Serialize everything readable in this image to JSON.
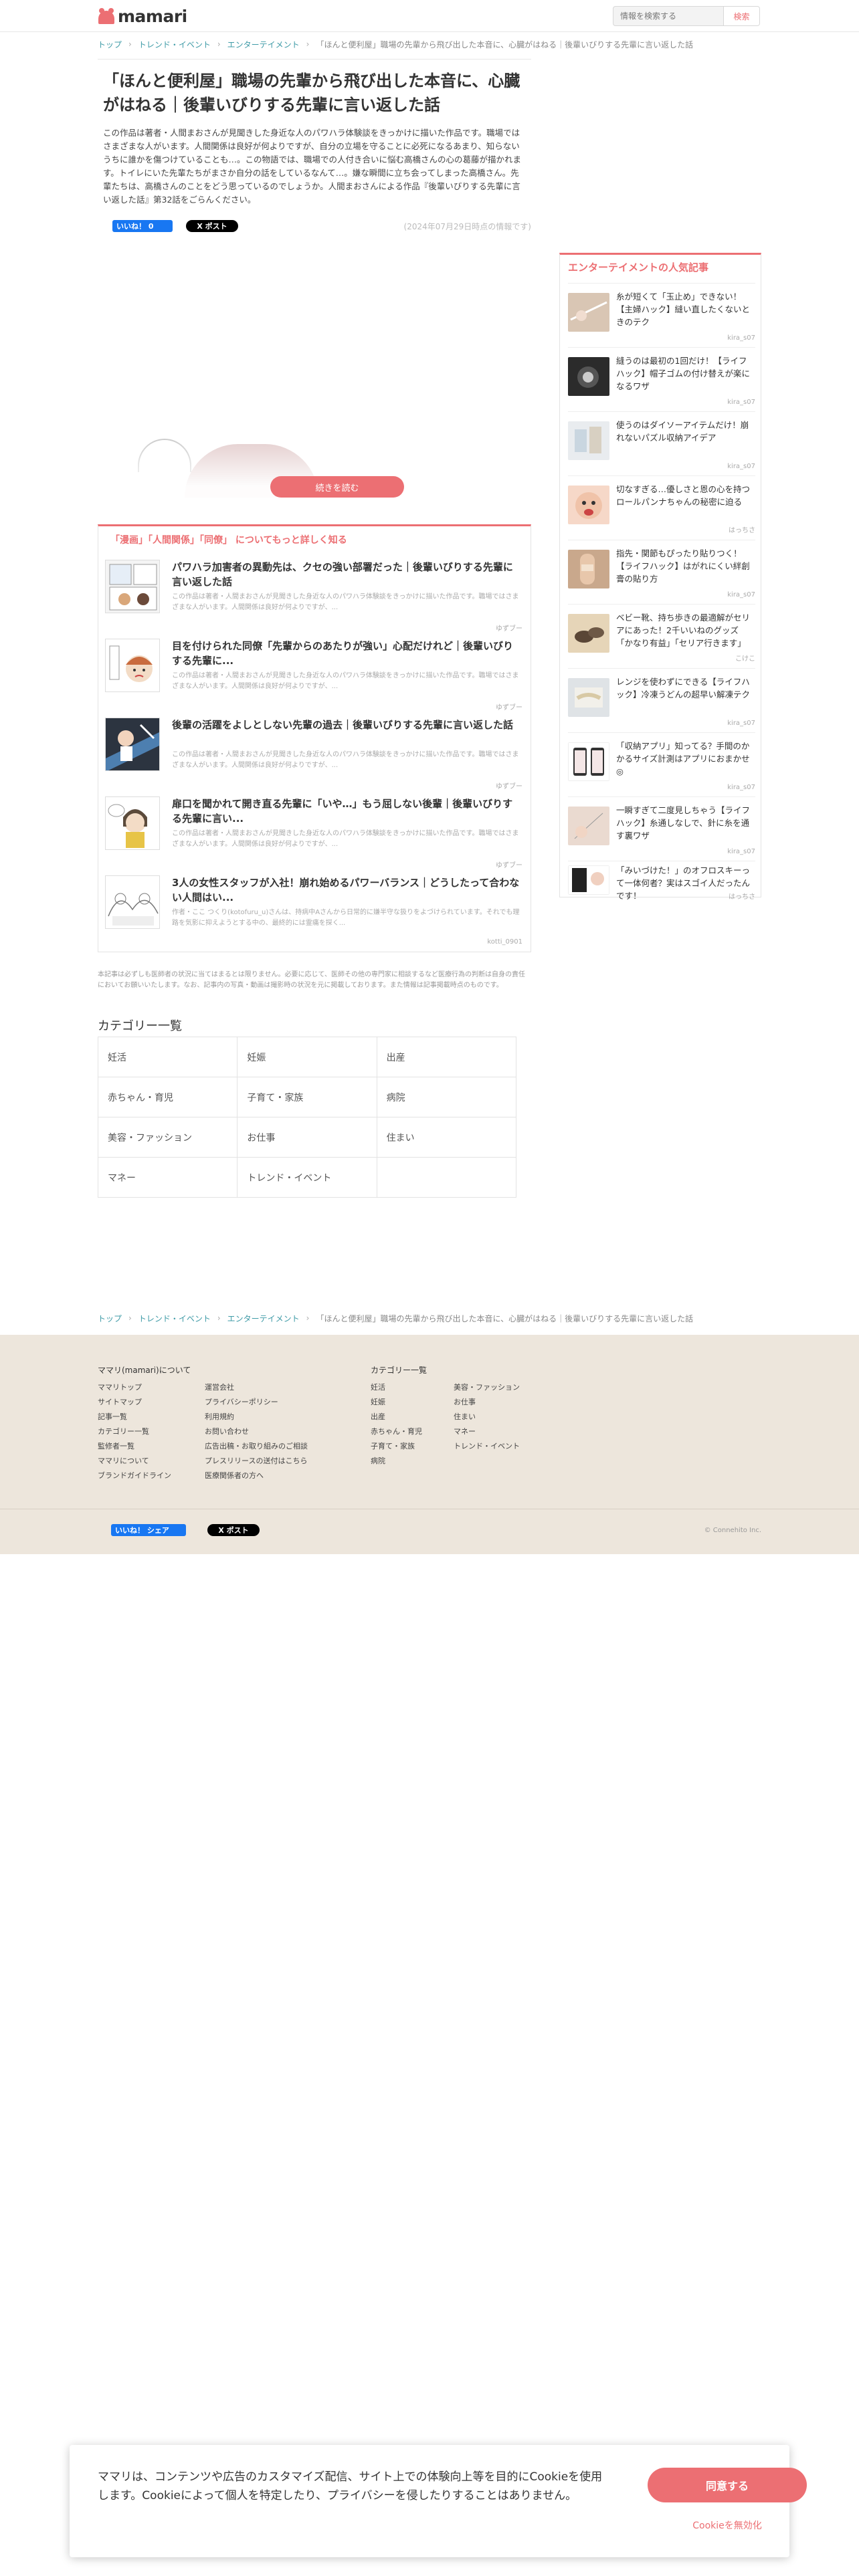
{
  "header": {
    "logo_text": "mamari",
    "search_placeholder": "情報を検索する",
    "search_button": "検索"
  },
  "breadcrumb": {
    "items": [
      "トップ",
      "トレンド・イベント",
      "エンターテイメント"
    ],
    "current": "「ほんと便利屋」職場の先輩から飛び出した本音に、心臓がはねる｜後輩いびりする先輩に言い返した話"
  },
  "article": {
    "title": "「ほんと便利屋」職場の先輩から飛び出した本音に、心臓がはねる｜後輩いびりする先輩に言い返した話",
    "lead": "この作品は著者・人間まおさんが見聞きした身近な人のパワハラ体験談をきっかけに描いた作品です。職場ではさまざまな人がいます。人間関係は良好が何よりですが、自分の立場を守ることに必死になるあまり、知らないうちに誰かを傷つけていることも…。この物語では、職場での人付き合いに悩む高橋さんの心の葛藤が描かれます。トイレにいた先輩たちがまさか自分の話をしているなんて…。嫌な瞬間に立ち会ってしまった高橋さん。先輩たちは、高橋さんのことをどう思っているのでしょうか。人間まおさんによる作品『後輩いびりする先輩に言い返した話』第32話をごらんください。",
    "fb_like": "いいね！ 0",
    "x_post": "X ポスト",
    "date": "(2024年07月29日時点の情報です)",
    "continue_button": "続きを読む"
  },
  "related": {
    "title": "「漫画」「人間関係」「同僚」 についてもっと詳しく知る",
    "items": [
      {
        "headline": "パワハラ加害者の異動先は、クセの強い部署だった｜後輩いびりする先輩に言い返した話",
        "desc": "この作品は著者・人間まおさんが見聞きした身近な人のパワハラ体験談をきっかけに描いた作品です。職場ではさまざまな人がいます。人間関係は良好が何よりですが、...",
        "author": "ゆずブー"
      },
      {
        "headline": "目を付けられた同僚「先輩からのあたりが強い」心配だけれど｜後輩いびりする先輩に...",
        "desc": "この作品は著者・人間まおさんが見聞きした身近な人のパワハラ体験談をきっかけに描いた作品です。職場ではさまざまな人がいます。人間関係は良好が何よりですが、...",
        "author": "ゆずブー"
      },
      {
        "headline": "後輩の活躍をよしとしない先輩の過去｜後輩いびりする先輩に言い返した話",
        "desc": "この作品は著者・人間まおさんが見聞きした身近な人のパワハラ体験談をきっかけに描いた作品です。職場ではさまざまな人がいます。人間関係は良好が何よりですが、...",
        "author": "ゆずブー"
      },
      {
        "headline": "扉口を聞かれて開き直る先輩に「いや…」もう屈しない後輩｜後輩いびりする先輩に言い...",
        "desc": "この作品は著者・人間まおさんが見聞きした身近な人のパワハラ体験談をきっかけに描いた作品です。職場ではさまざまな人がいます。人間関係は良好が何よりですが、...",
        "author": "ゆずブー"
      },
      {
        "headline": "3人の女性スタッフが入社！崩れ始めるパワーバランス｜どうしたって合わない人間はい...",
        "desc": "作者・ここ つくり(kotofuru_u)さんは、持病中Aさんから日常的に嫌半守な扱りをよづけられています。それでも理路を気影に抑えようとする中の、最終的には霊痛を探く...",
        "author": "kotti_0901"
      }
    ]
  },
  "disclaimer": "本記事は必ずしも医師者の状況に当てはまるとは限りません。必要に応じて、医師その他の専門家に相談するなど医療行為の判断は自身の責任においてお願いいたします。なお、記事内の写真・動画は撮影時の状況を元に掲載しております。また情報は記事掲載時点のものです。",
  "categories": {
    "title": "カテゴリー一覧",
    "items": [
      "妊活",
      "妊娠",
      "出産",
      "赤ちゃん・育児",
      "子育て・家族",
      "病院",
      "美容・ファッション",
      "お仕事",
      "住まい",
      "マネー",
      "トレンド・イベント",
      ""
    ]
  },
  "sidebar": {
    "title": "エンターテイメントの人気記事",
    "items": [
      {
        "text": "糸が短くて「玉止め」できない！【主婦ハック】縫い直したくないときのテク",
        "author": "kira_s07"
      },
      {
        "text": "縫うのは最初の1回だけ！【ライフハック】帽子ゴムの付け替えが楽になるワザ",
        "author": "kira_s07"
      },
      {
        "text": "使うのはダイソーアイテムだけ！崩れないパズル収納アイデア",
        "author": "kira_s07"
      },
      {
        "text": "切なすぎる…優しさと恩の心を持つロールパンナちゃんの秘密に迫る",
        "author": "はっちさ"
      },
      {
        "text": "指先・関節もぴったり貼りつく！【ライフハック】はがれにくい絆創膏の貼り方",
        "author": "kira_s07"
      },
      {
        "text": "ベビー靴、持ち歩きの最適解がセリアにあった！2千いいねのグッズ「かなり有益」「セリア行きます」",
        "author": "こけこ"
      },
      {
        "text": "レンジを使わずにできる【ライフハック】冷凍うどんの超早い解凍テク",
        "author": "kira_s07"
      },
      {
        "text": "「収納アプリ」知ってる？手間のかかるサイズ計測はアプリにおまかせ◎",
        "author": "kira_s07"
      },
      {
        "text": "一瞬すぎて二度見しちゃう【ライフハック】糸通しなしで、針に糸を通す裏ワザ",
        "author": "kira_s07"
      },
      {
        "text": "「みいづけた！」のオフロスキーって一体何者？実はスゴイ人だったんです！",
        "author": "はっちさ"
      }
    ]
  },
  "footer": {
    "about_title": "ママリ(mamari)について",
    "links_col1": [
      "ママリトップ",
      "サイトマップ",
      "記事一覧",
      "カテゴリー一覧",
      "監修者一覧",
      "ママリについて",
      "ブランドガイドライン"
    ],
    "links_col2": [
      "運営会社",
      "プライバシーポリシー",
      "利用規約",
      "お問い合わせ",
      "広告出稿・お取り組みのご相談",
      "プレスリリースの送付はこちら",
      "医療関係者の方へ"
    ],
    "cat_title": "カテゴリー一覧",
    "cat_col1": [
      "妊活",
      "妊娠",
      "出産",
      "赤ちゃん・育児",
      "子育て・家族",
      "病院"
    ],
    "cat_col2": [
      "美容・ファッション",
      "お仕事",
      "住まい",
      "マネー",
      "トレンド・イベント"
    ],
    "fb_share": "いいね！ シェア",
    "x_post": "X ポスト",
    "copyright": "© Connehito Inc."
  },
  "cookie": {
    "text": "ママリは、コンテンツや広告のカスタマイズ配信、サイト上での体験向上等を目的にCookieを使用します。Cookieによって個人を特定したり、プライバシーを侵したりすることはありません。",
    "accept": "同意する",
    "reject": "Cookieを無効化"
  },
  "colors": {
    "brand": "#ec6f73",
    "link": "#3f9ba7",
    "footer_bg": "#ede6dc"
  }
}
